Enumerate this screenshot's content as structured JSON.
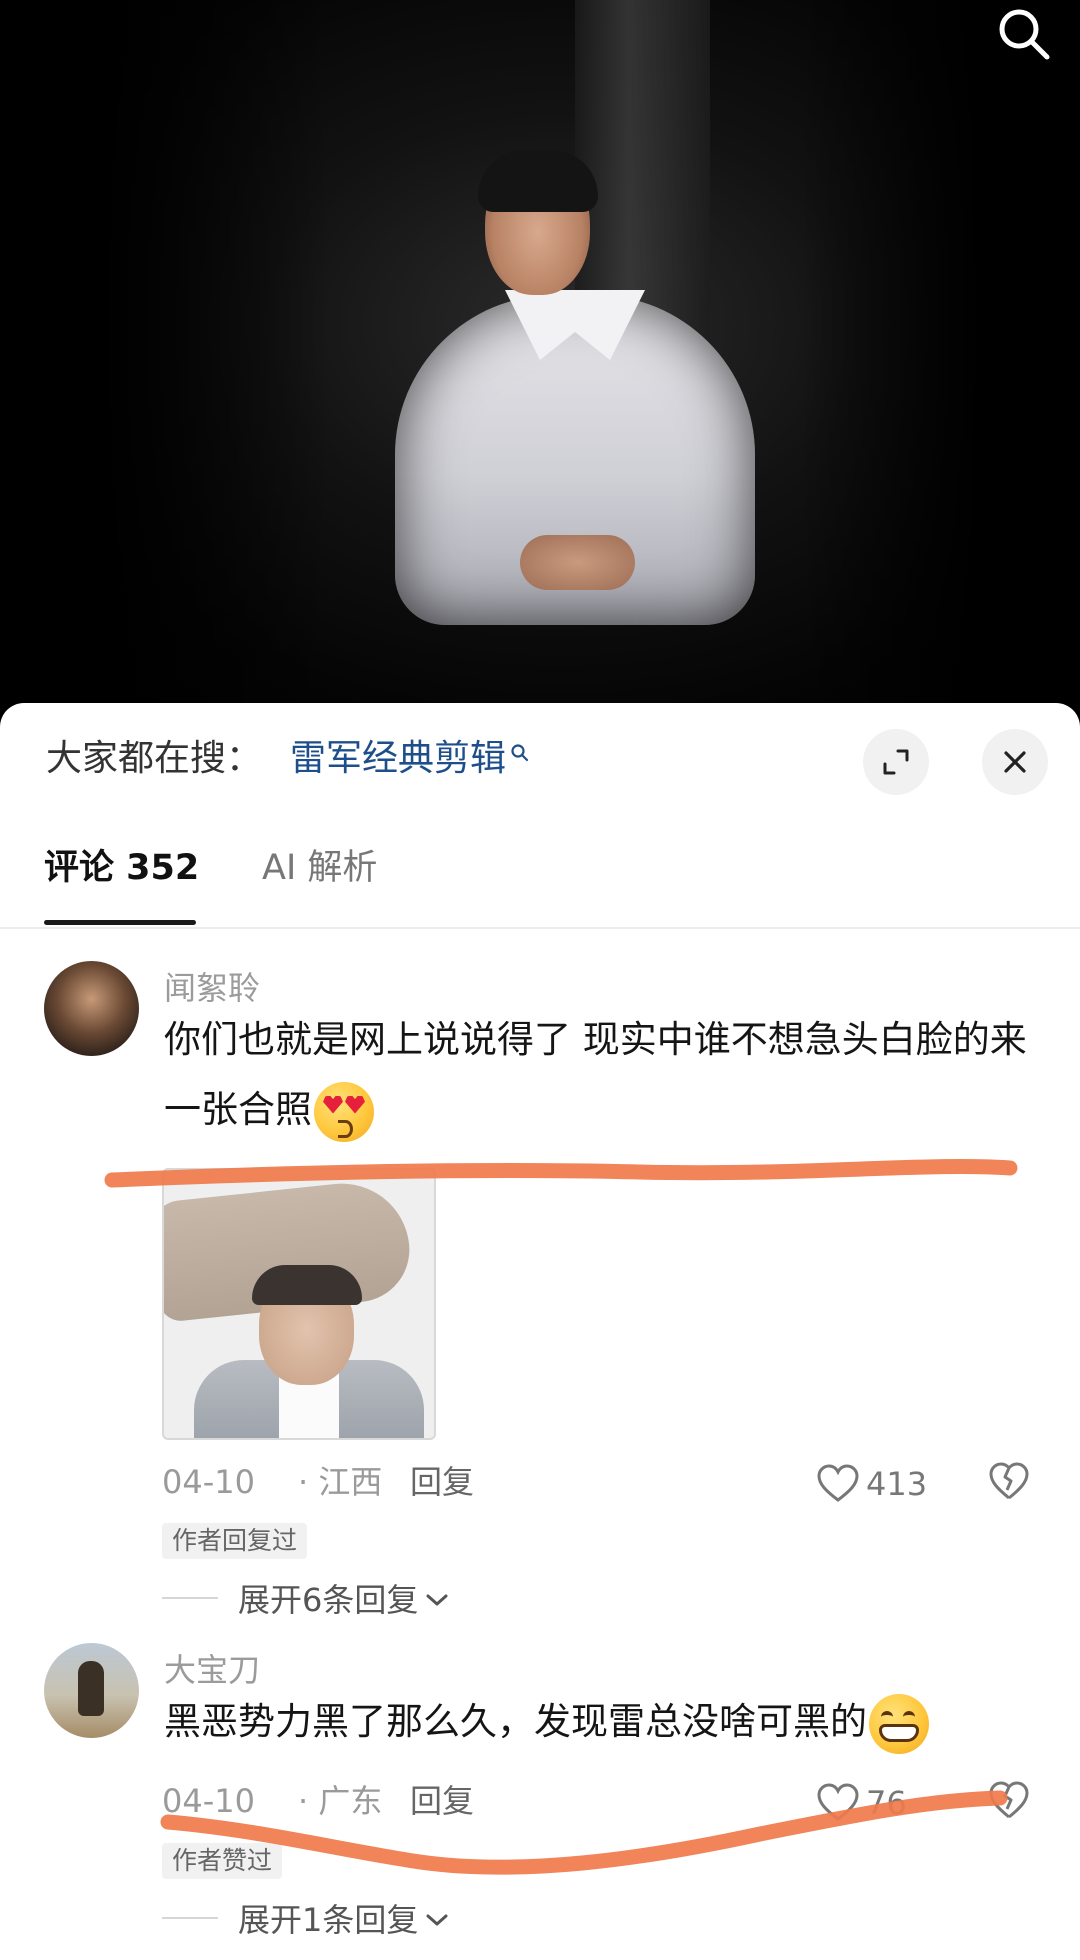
{
  "top": {
    "search_icon": "search-icon"
  },
  "sheet": {
    "trending_label": "大家都在搜：",
    "trending_query": "雷军经典剪辑",
    "expand_icon": "expand-icon",
    "close_icon": "close-icon"
  },
  "tabs": [
    {
      "label": "评论 352",
      "active": true
    },
    {
      "label": "AI 解析",
      "active": false
    }
  ],
  "comments": [
    {
      "username": "闻絮聆",
      "text": "你们也就是网上说说得了 现实中谁不想急头白脸的来一张合照",
      "emoji": "heart-eyes-emoji",
      "date": "04-10",
      "region": "· 江西",
      "reply_label": "回复",
      "likes": "413",
      "badge": "作者回复过",
      "expand_label": "展开6条回复"
    },
    {
      "username": "大宝刀",
      "text": "黑恶势力黑了那么久，发现雷总没啥可黑的",
      "emoji": "grin-emoji",
      "date": "04-10",
      "region": "· 广东",
      "reply_label": "回复",
      "likes": "76",
      "badge": "作者赞过",
      "expand_label": "展开1条回复"
    }
  ],
  "colors": {
    "accent_link": "#1e4f8a",
    "scribble": "#f07a4a",
    "text_primary": "#151515",
    "text_secondary": "#9a9a9a"
  }
}
